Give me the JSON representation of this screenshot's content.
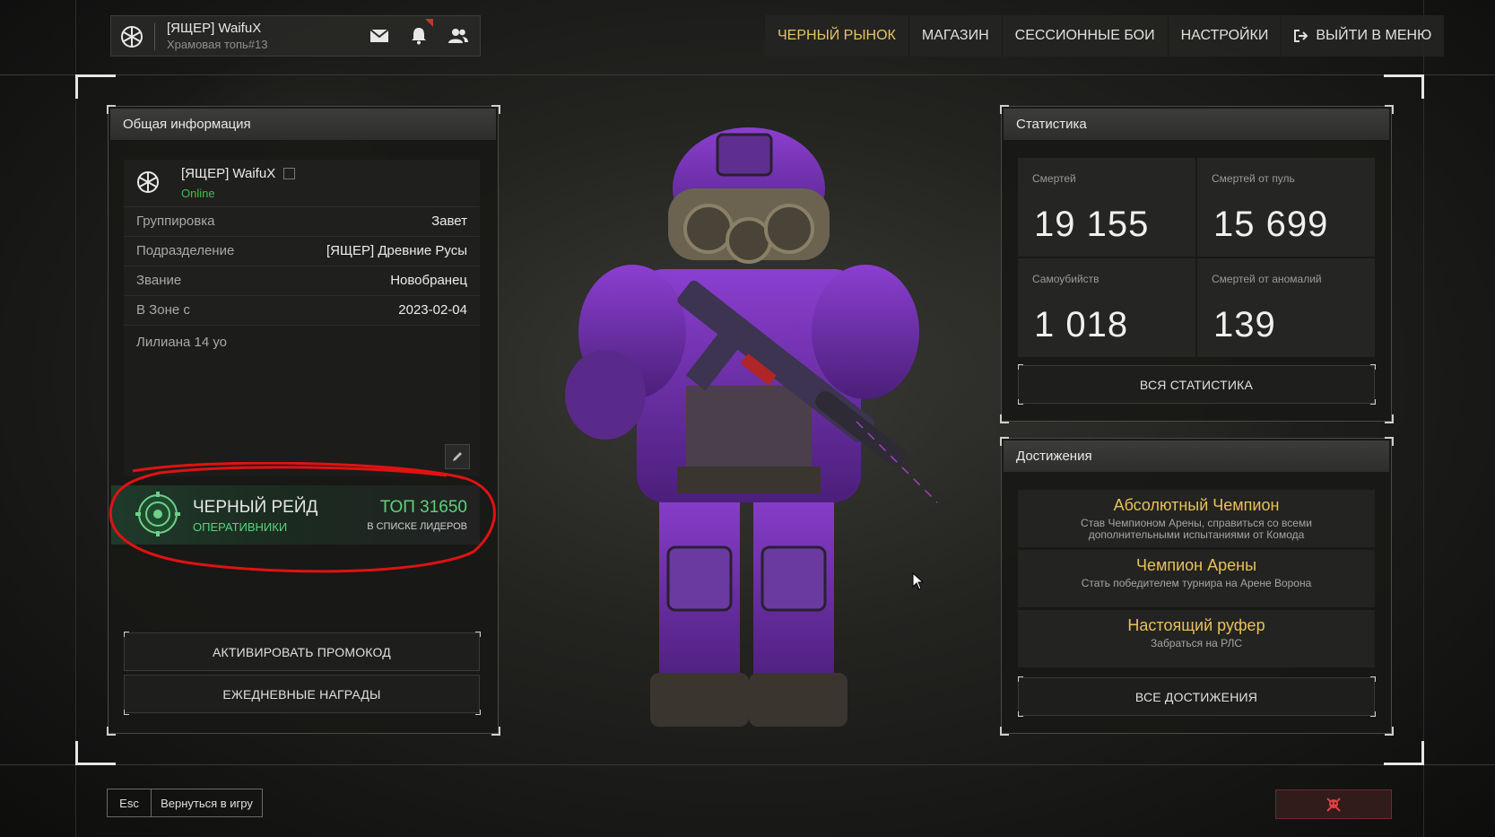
{
  "profile": {
    "name": "[ЯЩЕР] WaifuX",
    "clan_line": "Храмовая топь#13",
    "emblem_icon": "snowflake-emblem-icon",
    "mail_icon": "mail-icon",
    "bell_icon": "bell-icon",
    "friends_icon": "friends-icon"
  },
  "nav": {
    "items": [
      "ЧЕРНЫЙ РЫНОК",
      "МАГАЗИН",
      "СЕССИОННЫЕ БОИ",
      "НАСТРОЙКИ",
      "ВЫЙТИ В МЕНЮ"
    ],
    "active_index": 0,
    "accent": "#e7c36a"
  },
  "info_panel": {
    "title": "Общая информация",
    "player_name": "[ЯЩЕР] WaifuX",
    "status": "Online",
    "status_color": "#3ec14a",
    "rows": [
      {
        "label": "Группировка",
        "value": "Завет"
      },
      {
        "label": "Подразделение",
        "value": "[ЯЩЕР] Древние Русы"
      },
      {
        "label": "Звание",
        "value": "Новобранец"
      },
      {
        "label": "В Зоне с",
        "value": "2023-02-04"
      }
    ],
    "bio": "Лилиана 14 уо"
  },
  "raid": {
    "title": "ЧЕРНЫЙ РЕЙД",
    "subtitle": "ОПЕРАТИВНИКИ",
    "rank": "ТОП 31650",
    "rank_caption": "В СПИСКЕ ЛИДЕРОВ",
    "accent": "#5fd17a"
  },
  "buttons": {
    "promo": "АКТИВИРОВАТЬ ПРОМОКОД",
    "daily": "ЕЖЕДНЕВНЫЕ НАГРАДЫ"
  },
  "stats": {
    "title": "Статистика",
    "cells": [
      {
        "label": "Смертей",
        "value": "19 155"
      },
      {
        "label": "Смертей от пуль",
        "value": "15 699"
      },
      {
        "label": "Самоубийств",
        "value": "1 018"
      },
      {
        "label": "Смертей от аномалий",
        "value": "139"
      }
    ],
    "all_button": "ВСЯ СТАТИСТИКА"
  },
  "achievements": {
    "title": "Достижения",
    "items": [
      {
        "title": "Абсолютный Чемпион",
        "desc": "Став Чемпионом Арены, справиться со всеми дополнительными испытаниями от Комода"
      },
      {
        "title": "Чемпион Арены",
        "desc": "Стать победителем турнира на Арене Ворона"
      },
      {
        "title": "Настоящий руфер",
        "desc": "Забраться на РЛС"
      }
    ],
    "all_button": "ВСЕ ДОСТИЖЕНИЯ"
  },
  "footer": {
    "esc_key": "Esc",
    "esc_label": "Вернуться в игру"
  }
}
